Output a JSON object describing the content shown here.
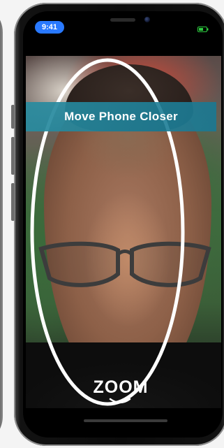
{
  "status_bar": {
    "time": "9:41",
    "time_pill_color": "#2979ff",
    "battery_icon": "battery-icon",
    "battery_color": "#2ecc40"
  },
  "verification": {
    "prompt": "Move Phone Closer",
    "banner_color": "#1f8ea6",
    "frame_icon": "face-oval-frame"
  },
  "branding": {
    "logo_text": "ZOOM"
  }
}
